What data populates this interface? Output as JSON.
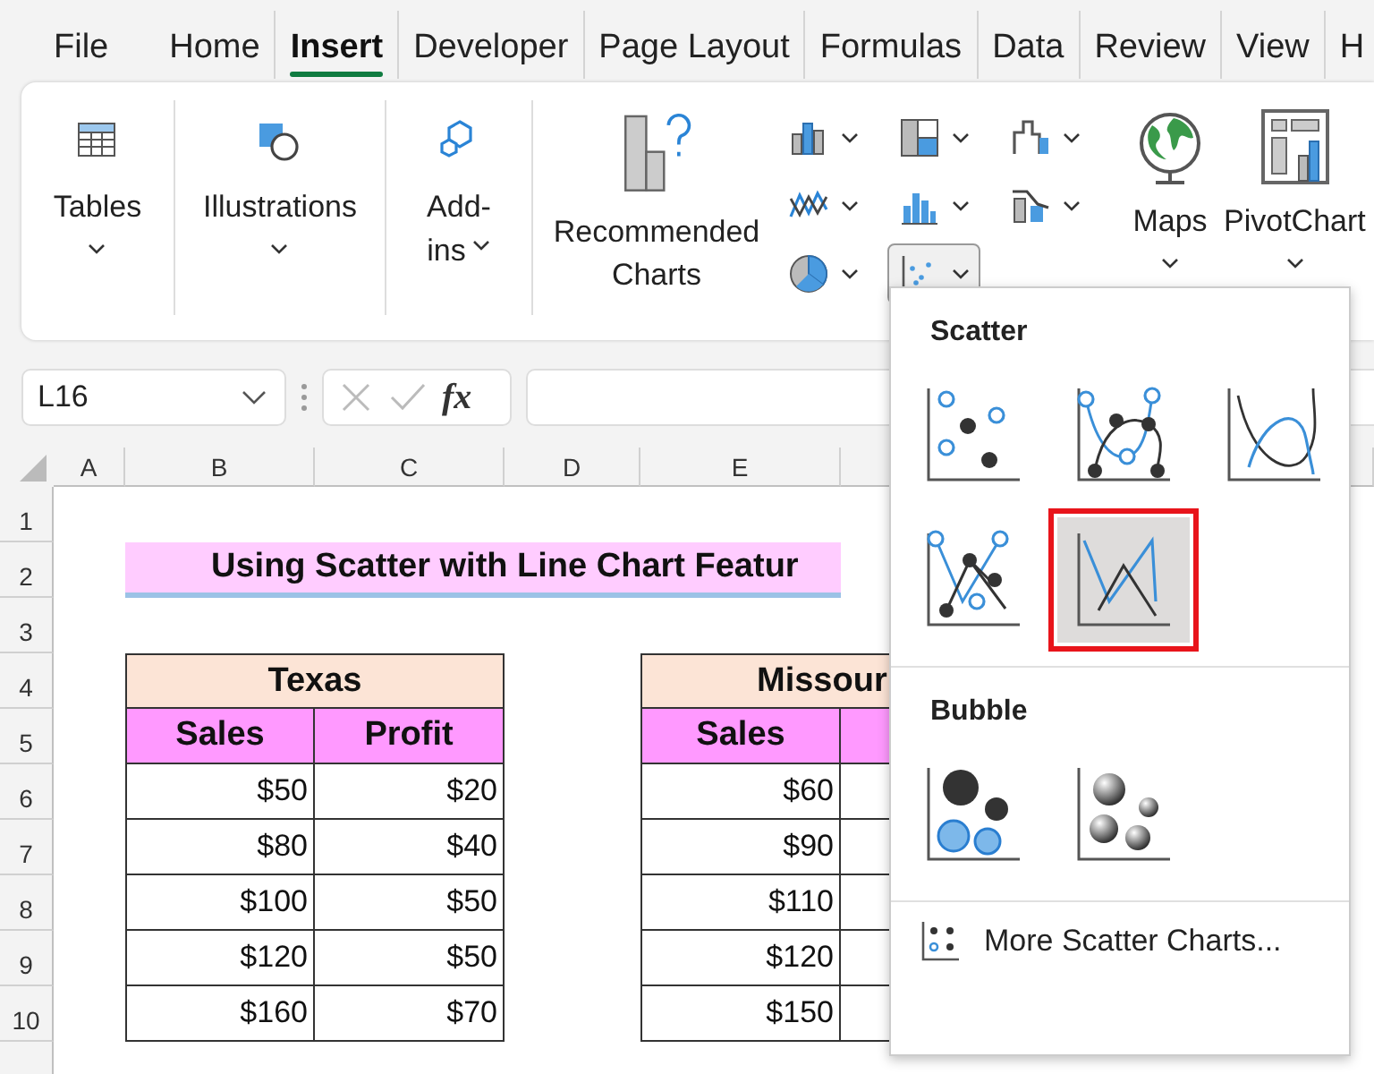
{
  "tabs": [
    {
      "label": "File",
      "selected": false
    },
    {
      "label": "Home",
      "selected": false
    },
    {
      "label": "Insert",
      "selected": true
    },
    {
      "label": "Developer",
      "selected": false
    },
    {
      "label": "Page Layout",
      "selected": false
    },
    {
      "label": "Formulas",
      "selected": false
    },
    {
      "label": "Data",
      "selected": false
    },
    {
      "label": "Review",
      "selected": false
    },
    {
      "label": "View",
      "selected": false
    },
    {
      "label": "H",
      "selected": false
    }
  ],
  "ribbon": {
    "groups": [
      {
        "kind": "tables",
        "label": "Tables"
      },
      {
        "kind": "illustrations",
        "label": "Illustrations"
      },
      {
        "kind": "addins",
        "label": "Add-ins"
      }
    ],
    "recommended_label": "Recommended Charts",
    "chart_buttons": [
      {
        "kind": "column",
        "expanded": false
      },
      {
        "kind": "line",
        "expanded": false
      },
      {
        "kind": "pie",
        "expanded": false
      },
      {
        "kind": "hierarchy",
        "expanded": false
      },
      {
        "kind": "statistic",
        "expanded": false
      },
      {
        "kind": "scatter",
        "expanded": true
      },
      {
        "kind": "waterfall",
        "expanded": false
      },
      {
        "kind": "combo",
        "expanded": false
      }
    ],
    "tail_buttons": [
      {
        "kind": "maps",
        "label": "Maps"
      },
      {
        "kind": "pivotchart",
        "label": "PivotChart"
      }
    ]
  },
  "formula_bar": {
    "name_box": "L16",
    "function_label": "fx"
  },
  "sheet": {
    "columns": [
      "A",
      "B",
      "C",
      "D",
      "E"
    ],
    "rows": [
      "1",
      "2",
      "3",
      "4",
      "5",
      "6",
      "7",
      "8",
      "9",
      "10"
    ],
    "title": "Using Scatter with Line Chart Featur",
    "tables": [
      {
        "title": "Texas",
        "columns": [
          "Sales",
          "Profit"
        ],
        "rows": [
          [
            "$50",
            "$20"
          ],
          [
            "$80",
            "$40"
          ],
          [
            "$100",
            "$50"
          ],
          [
            "$120",
            "$50"
          ],
          [
            "$160",
            "$70"
          ]
        ]
      },
      {
        "title": "Missour",
        "columns": [
          "Sales"
        ],
        "rows": [
          [
            "$60"
          ],
          [
            "$90"
          ],
          [
            "$110"
          ],
          [
            "$120"
          ],
          [
            "$150"
          ]
        ]
      }
    ]
  },
  "gallery": {
    "sections": [
      {
        "title": "Scatter",
        "items": [
          {
            "kind": "markers",
            "selected": false
          },
          {
            "kind": "smooth-markers",
            "selected": false
          },
          {
            "kind": "smooth",
            "selected": false
          },
          {
            "kind": "straight-markers",
            "selected": false
          },
          {
            "kind": "straight",
            "selected": true
          }
        ]
      },
      {
        "title": "Bubble",
        "items": [
          {
            "kind": "bubble",
            "selected": false
          },
          {
            "kind": "bubble-3d",
            "selected": false
          }
        ]
      }
    ],
    "more_link": "More Scatter Charts..."
  }
}
